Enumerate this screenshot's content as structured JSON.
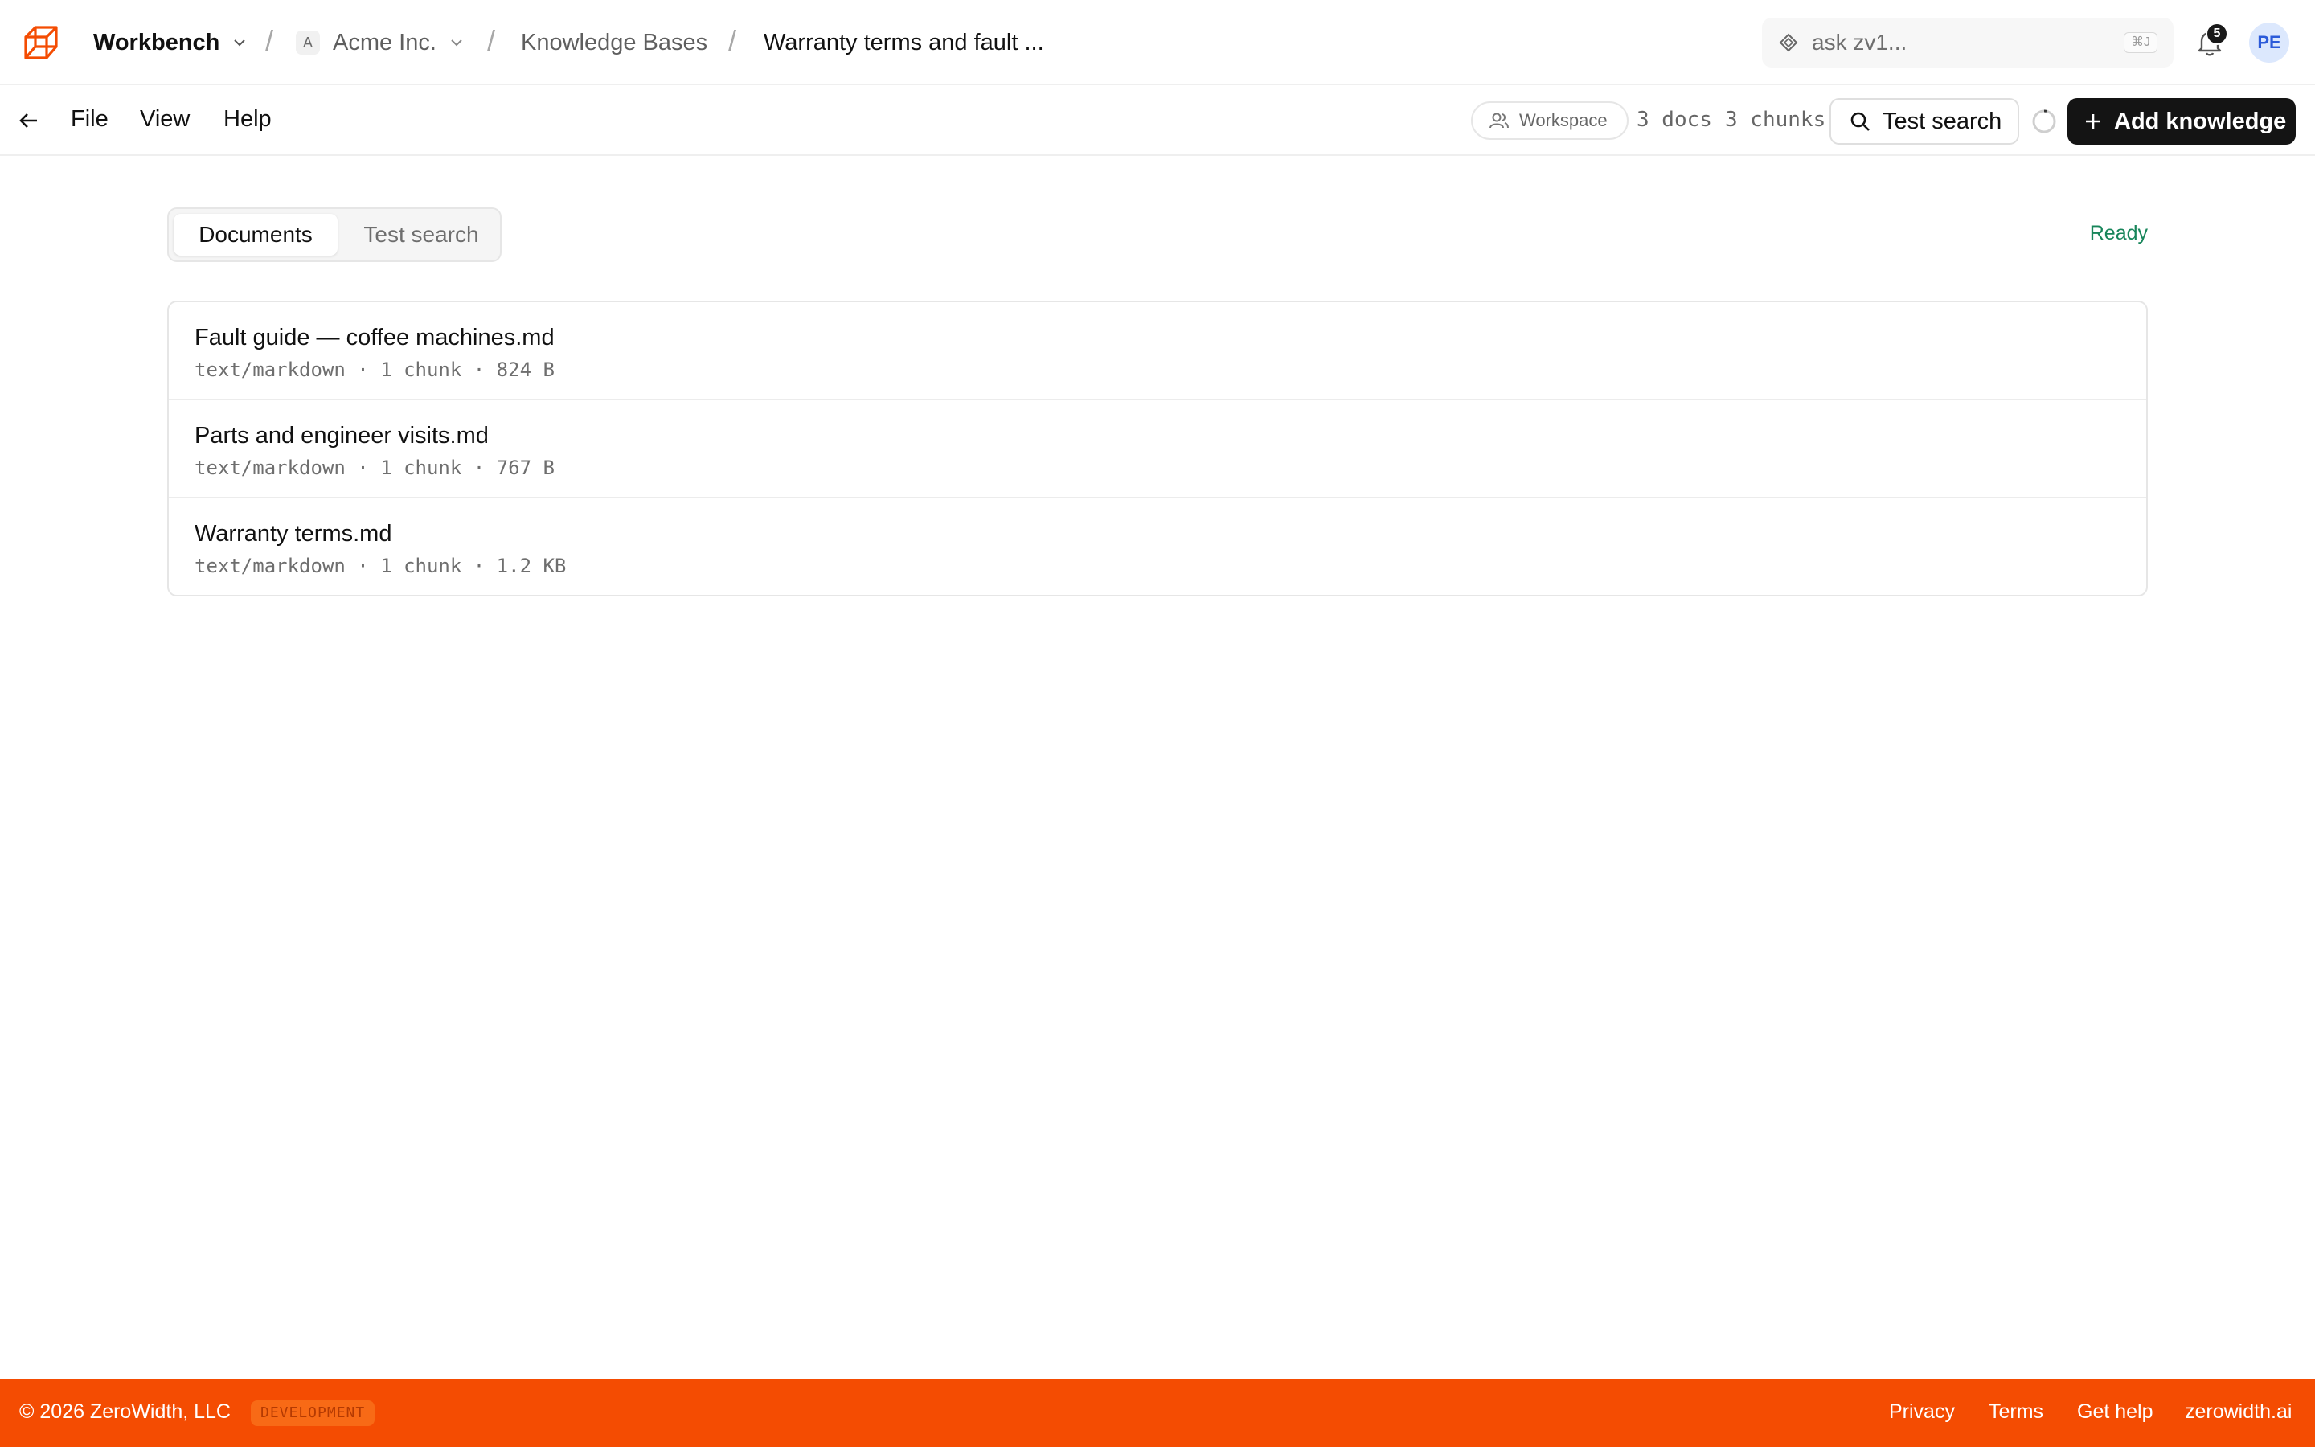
{
  "header": {
    "app_switcher": "Workbench",
    "org": {
      "initial": "A",
      "name": "Acme Inc."
    },
    "breadcrumb_section": "Knowledge Bases",
    "breadcrumb_current": "Warranty terms and fault ...",
    "separator": "/",
    "search": {
      "placeholder": "ask zv1...",
      "shortcut": "⌘J"
    },
    "notifications_count": "5",
    "avatar_initials": "PE"
  },
  "menubar": {
    "items": [
      "File",
      "View",
      "Help"
    ],
    "visibility": "Workspace",
    "docs_count": "3 docs",
    "chunks_count": "3 chunks",
    "test_search_label": "Test search",
    "add_knowledge_label": "Add knowledge"
  },
  "tabs": [
    {
      "label": "Documents",
      "active": true
    },
    {
      "label": "Test search",
      "active": false
    }
  ],
  "status": "Ready",
  "documents": [
    {
      "title": "Fault guide — coffee machines.md",
      "meta": "text/markdown · 1 chunk · 824 B"
    },
    {
      "title": "Parts and engineer visits.md",
      "meta": "text/markdown · 1 chunk · 767 B"
    },
    {
      "title": "Warranty terms.md",
      "meta": "text/markdown · 1 chunk · 1.2 KB"
    }
  ],
  "footer": {
    "copyright": "© 2026 ZeroWidth, LLC",
    "environment": "DEVELOPMENT",
    "links": [
      "Privacy",
      "Terms",
      "Get help",
      "zerowidth.ai"
    ]
  },
  "colors": {
    "brand": "#f44c02",
    "ready": "#17855a",
    "primary_button": "#141414"
  }
}
